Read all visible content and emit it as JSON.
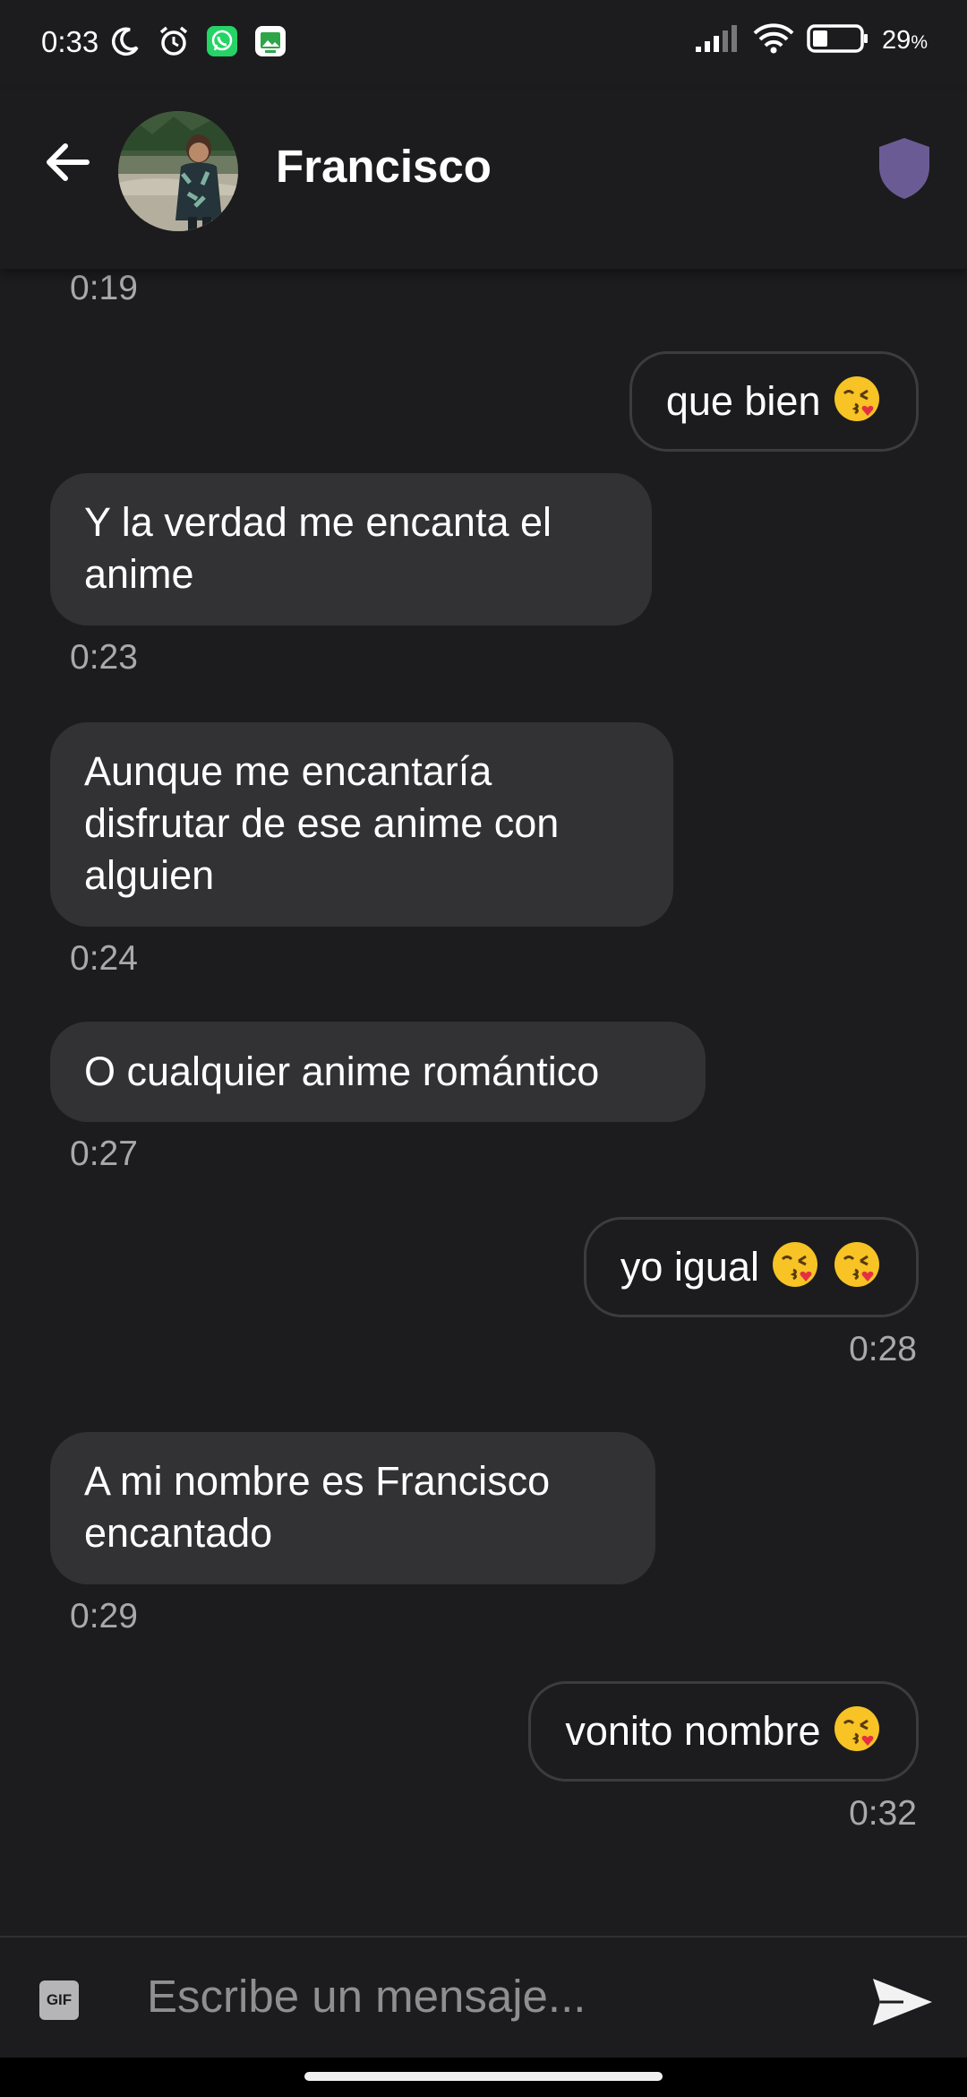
{
  "status_bar": {
    "time": "0:33",
    "battery_percent": "29",
    "battery_unit": "%"
  },
  "header": {
    "contact_name": "Francisco",
    "accent_color": "#6b5b95"
  },
  "messages": [
    {
      "side": "in",
      "text": "",
      "time": "0:19"
    },
    {
      "side": "out",
      "text": "que bien",
      "emoji": "kiss-face",
      "time": ""
    },
    {
      "side": "in",
      "line1": "Y la verdad me encanta el",
      "line2": "anime",
      "time": "0:23"
    },
    {
      "side": "in",
      "line1": "Aunque me encantaría",
      "line2": "disfrutar de ese anime con",
      "line3": "alguien",
      "time": "0:24"
    },
    {
      "side": "in",
      "line1": "O cualquier anime romántico",
      "time": "0:27"
    },
    {
      "side": "out",
      "text": "yo igual",
      "emoji": "kiss-face",
      "time": "0:28"
    },
    {
      "side": "in",
      "line1": "A mi nombre es Francisco",
      "line2": "encantado",
      "time": "0:29"
    },
    {
      "side": "out",
      "text": "vonito nombre",
      "emoji": "kiss-face",
      "time": "0:32"
    }
  ],
  "composer": {
    "gif_label": "GIF",
    "placeholder": "Escribe un mensaje..."
  }
}
